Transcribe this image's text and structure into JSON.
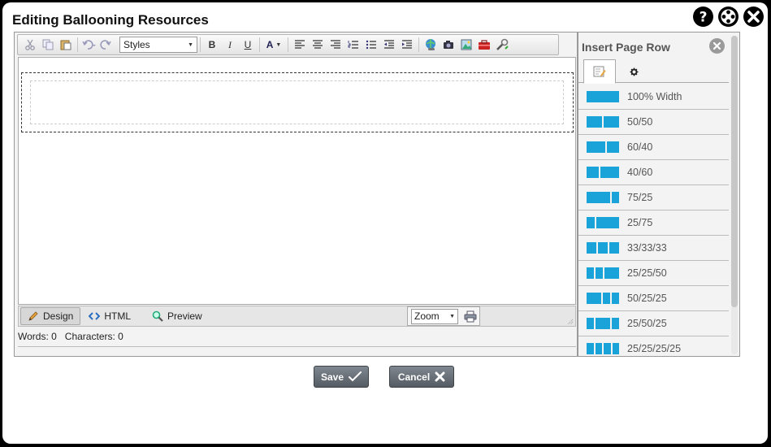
{
  "window": {
    "title": "Editing Ballooning Resources"
  },
  "toolbar": {
    "styles_label": "Styles",
    "bold_label": "B",
    "italic_label": "I",
    "underline_label": "U",
    "font_color_label": "A"
  },
  "mode_bar": {
    "design_label": "Design",
    "html_label": "HTML",
    "preview_label": "Preview",
    "zoom_label": "Zoom"
  },
  "status": {
    "words": "Words: 0",
    "characters": "Characters: 0"
  },
  "sidebar": {
    "title": "Insert Page Row",
    "layouts": [
      {
        "label": "100% Width",
        "parts": [
          100
        ]
      },
      {
        "label": "50/50",
        "parts": [
          50,
          50
        ]
      },
      {
        "label": "60/40",
        "parts": [
          60,
          40
        ]
      },
      {
        "label": "40/60",
        "parts": [
          40,
          60
        ]
      },
      {
        "label": "75/25",
        "parts": [
          75,
          25
        ]
      },
      {
        "label": "25/75",
        "parts": [
          25,
          75
        ]
      },
      {
        "label": "33/33/33",
        "parts": [
          33,
          33,
          33
        ]
      },
      {
        "label": "25/25/50",
        "parts": [
          25,
          25,
          50
        ]
      },
      {
        "label": "50/25/25",
        "parts": [
          50,
          25,
          25
        ]
      },
      {
        "label": "25/50/25",
        "parts": [
          25,
          50,
          25
        ]
      },
      {
        "label": "25/25/25/25",
        "parts": [
          25,
          25,
          25,
          25
        ]
      }
    ]
  },
  "buttons": {
    "save_label": "Save",
    "cancel_label": "Cancel"
  },
  "colors": {
    "layout_accent": "#1aa3d9",
    "button_bg": "#5f666d"
  }
}
